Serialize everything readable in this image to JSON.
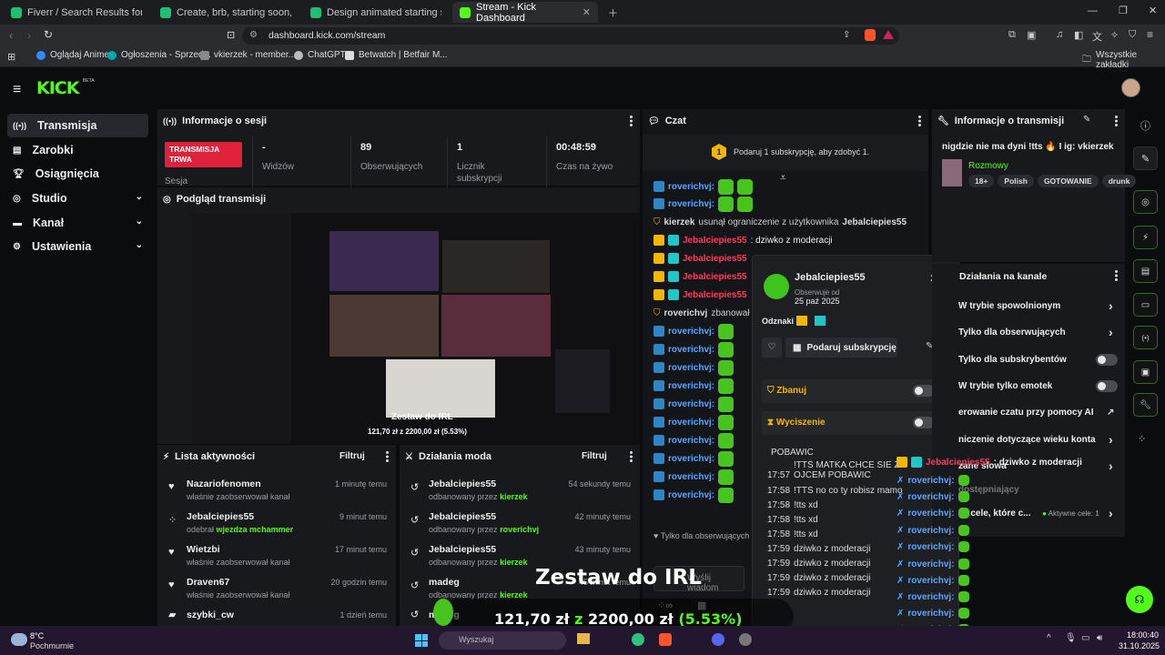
{
  "browser": {
    "tabs": [
      {
        "label": "Fiverr / Search Results for 'start soon'",
        "color": "#1dbf73"
      },
      {
        "label": "Create, brb, starting soon, offline scr",
        "color": "#1dbf73"
      },
      {
        "label": "Design animated starting soon, brb,",
        "color": "#1dbf73"
      },
      {
        "label": "Stream - Kick Dashboard",
        "color": "#53fc18"
      }
    ],
    "url": "dashboard.kick.com/stream",
    "bookmarks": [
      "Oglądaj Anime",
      "Ogłoszenia - Sprzed...",
      "vkierzek - member...",
      "ChatGPT",
      "Betwatch | Betfair M..."
    ],
    "all_bookmarks": "Wszystkie zakładki"
  },
  "app": {
    "logo": "KICK",
    "logo_tag": "BETA",
    "accent": "#53fc18",
    "nav": [
      {
        "label": "Transmisja"
      },
      {
        "label": "Zarobki"
      },
      {
        "label": "Osiągnięcia"
      },
      {
        "label": "Studio"
      },
      {
        "label": "Kanał"
      },
      {
        "label": "Ustawienia"
      }
    ]
  },
  "session": {
    "title": "Informacje o sesji",
    "live_badge": "TRANSMISJA TRWA",
    "live_sub": "Sesja",
    "stats": [
      {
        "value": "-",
        "label": "Widzów"
      },
      {
        "value": "89",
        "label": "Obserwujących"
      },
      {
        "value": "1",
        "label": "Licznik subskrypcji"
      },
      {
        "value": "00:48:59",
        "label": "Czas na żywo"
      }
    ]
  },
  "preview": {
    "title": "Podgląd transmisji",
    "overlay_title": "Zestaw do IRL",
    "overlay_amount": "121,70 zł z 2200,00 zł (5.53%)",
    "goal_fraction": 0.0553
  },
  "activity": {
    "title": "Lista aktywności",
    "filter": "Filtruj",
    "items": [
      {
        "name": "Nazariofenomen",
        "sub": "właśnie zaobserwował kanał",
        "time": "1 minutę temu"
      },
      {
        "name": "Jebalciepies55",
        "sub": "odebrał",
        "sub_hl": "wjezdza mchammer",
        "time": "9 minut temu"
      },
      {
        "name": "Wietzbi",
        "sub": "właśnie zaobserwował kanał",
        "time": "17 minut temu"
      },
      {
        "name": "Draven67",
        "sub": "właśnie zaobserwował kanał",
        "time": "20 godzin temu"
      },
      {
        "name": "szybki_cw",
        "sub": "",
        "time": "1 dzień temu"
      }
    ]
  },
  "modactions": {
    "title": "Działania moda",
    "filter": "Filtruj",
    "items": [
      {
        "name": "Jebalciepies55",
        "sub": "odbanowany przez",
        "by": "kierzek",
        "time": "54 sekundy temu"
      },
      {
        "name": "Jebalciepies55",
        "sub": "odbanowany przez",
        "by": "roverichvj",
        "time": "42 minuty temu"
      },
      {
        "name": "Jebalciepies55",
        "sub": "odbanowany przez",
        "by": "kierzek",
        "time": "43 minuty temu"
      },
      {
        "name": "madeg",
        "sub": "odbanowany przez",
        "by": "kierzek",
        "time": "45 minut temu"
      },
      {
        "name": "madeg",
        "sub": "",
        "by": "",
        "time": ""
      }
    ]
  },
  "chat": {
    "title": "Czat",
    "gift_prompt": "Podaruj 1 subskrypcję, aby zdobyć 1.",
    "sys_line": {
      "user": "kierzek",
      "text": "usunął ograniczenie z użytkownika",
      "target": "Jebalciepies55"
    },
    "first_msg": {
      "user": "Jebalciepies55",
      "text": ": dziwko z moderacji"
    },
    "ban_line": {
      "user": "roverichvj",
      "text": "zbanował J"
    },
    "repeat_user": "roverichvj:",
    "red_user": "Jebalciepies55",
    "followers_only": "Tylko dla obserwujących",
    "input_placeholder": "Wyślij wiadom"
  },
  "popup": {
    "username": "Jebalciepies55",
    "follow_label": "Obserwuje od",
    "follow_date": "25 paź 2025",
    "badges_label": "Odznaki",
    "gift_button": "Podaruj subskrypcję",
    "ban_label": "Zbanuj",
    "mute_label": "Wyciszenie",
    "messages": [
      {
        "time": "",
        "text": "POBAWIC"
      },
      {
        "time": "17:57",
        "text": "!TTS MATKA CHCE SIE Z OJCEM POBAWIC"
      },
      {
        "time": "17:58",
        "text": "!TTS no co ty robisz mamo"
      },
      {
        "time": "17:58",
        "text": "!tts xd"
      },
      {
        "time": "17:58",
        "text": "!tts xd"
      },
      {
        "time": "17:58",
        "text": "!tts xd"
      },
      {
        "time": "17:59",
        "text": "dziwko z moderacji"
      },
      {
        "time": "17:59",
        "text": "dziwko z moderacji"
      },
      {
        "time": "17:59",
        "text": "dziwko z moderacji"
      },
      {
        "time": "17:59",
        "text": "dziwko z moderacji"
      }
    ]
  },
  "streaminfo": {
    "title": "Informacje o transmisji",
    "stream_title": "nigdzie nie ma dyni !tts 🔥 I ig: vkierzek",
    "category": "Rozmowy",
    "tags": [
      "18+",
      "Polish",
      "GOTOWANIE",
      "drunk"
    ]
  },
  "channel_actions": {
    "title": "Działania na kanale",
    "items": [
      {
        "label": "W trybie spowolnionym",
        "control": "arrow"
      },
      {
        "label": "Tylko dla obserwujących",
        "control": "arrow"
      },
      {
        "label": "Tylko dla subskrybentów",
        "control": "toggle"
      },
      {
        "label": "W trybie tylko emotek",
        "control": "toggle"
      },
      {
        "label": "erowanie czatu przy pomocy AI",
        "control": "link"
      },
      {
        "label": "niczenie dotyczące wieku konta",
        "control": "arrow"
      },
      {
        "label": "zane słowa",
        "control": "arrow"
      },
      {
        "label": "dostępniający",
        "control": ""
      },
      {
        "label": "cz cele, które c...",
        "control": "arrow"
      }
    ],
    "active_goals": "Aktywne cele: 1",
    "overlay_msg": {
      "user": "Jebalciepies55",
      "text": ": dziwko z moderacji"
    }
  },
  "stream_overlay": {
    "title": "Zestaw do IRL",
    "current": "121,70 zł",
    "of": "z",
    "target": "2200,00 zł",
    "percent": "(5.53%)"
  },
  "taskbar": {
    "temp": "8°C",
    "weather": "Pochmurnie",
    "search": "Wyszukaj",
    "time": "18:00:40",
    "date": "31.10.2025"
  }
}
